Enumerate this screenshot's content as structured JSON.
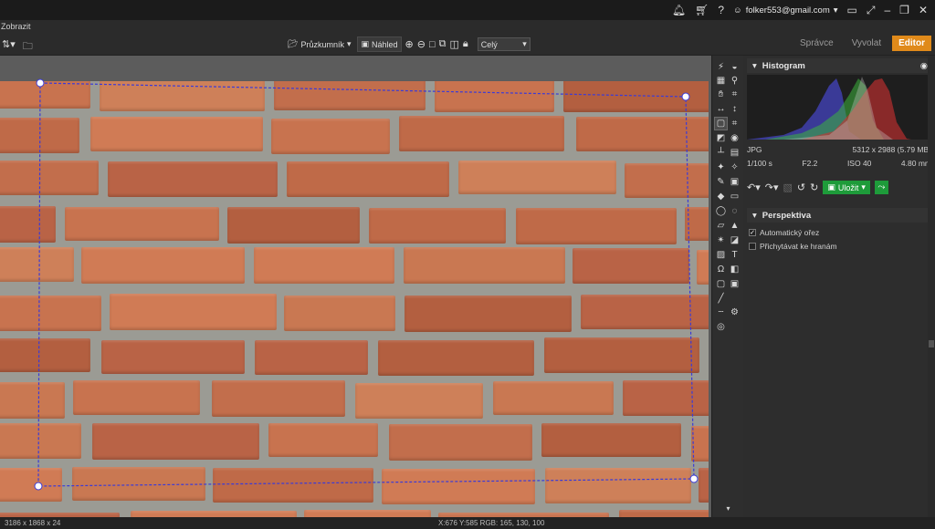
{
  "topbar": {
    "icons": [
      "bell-icon",
      "cart-icon",
      "help-icon"
    ],
    "email": "folker553@gmail.com",
    "window_icons": [
      "monitor-icon",
      "expand-icon",
      "minimize-icon",
      "restore-icon",
      "close-icon"
    ]
  },
  "menu": {
    "item": "Zobrazit"
  },
  "toolbar": {
    "explorer": "Průzkumník",
    "preview": "Náhled",
    "zoom_value": "Celý"
  },
  "modes": {
    "manager": "Správce",
    "develop": "Vyvolat",
    "editor": "Editor"
  },
  "panel": {
    "histogram_title": "Histogram",
    "format": "JPG",
    "dimensions": "5312 x 2988 (5.79 MB)",
    "shutter": "1/100 s",
    "aperture": "F2.2",
    "iso": "ISO 40",
    "focal": "4.80 mm",
    "save_label": "Uložit",
    "perspective_title": "Perspektiva",
    "auto_crop": "Automatický ořez",
    "snap_edges": "Přichytávat ke hranám"
  },
  "status": {
    "image_info": "3186 x 1868 x 24",
    "cursor_info": "X:676 Y:585   RGB: 165, 130, 100"
  },
  "colors": {
    "accent": "#e08a1a",
    "save_green": "#1e9b3a",
    "crop_line": "#3a3ad8"
  }
}
